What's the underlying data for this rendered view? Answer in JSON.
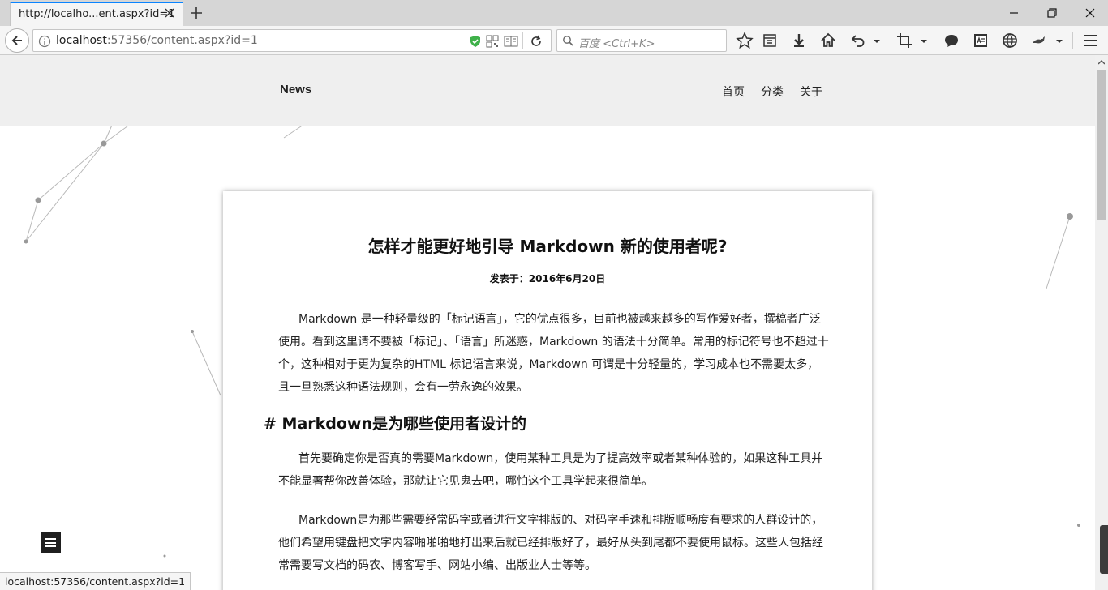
{
  "browser": {
    "tab_title": "http://localho...ent.aspx?id=1",
    "url_host": "localhost",
    "url_rest": ":57356/content.aspx?id=1",
    "search_placeholder": "百度 <Ctrl+K>",
    "status_url": "localhost:57356/content.aspx?id=1"
  },
  "site": {
    "brand": "News",
    "nav": [
      "首页",
      "分类",
      "关于"
    ]
  },
  "article": {
    "title": "怎样才能更好地引导 Markdown 新的使用者呢?",
    "date": "发表于：2016年6月20日",
    "p1": "Markdown 是一种轻量级的「标记语言」，它的优点很多，目前也被越来越多的写作爱好者，撰稿者广泛使用。看到这里请不要被「标记」、「语言」所迷惑，Markdown 的语法十分简单。常用的标记符号也不超过十个，这种相对于更为复杂的HTML 标记语言来说，Markdown 可谓是十分轻量的，学习成本也不需要太多，且一旦熟悉这种语法规则，会有一劳永逸的效果。",
    "h2": "# Markdown是为哪些使用者设计的",
    "p2": "首先要确定你是否真的需要Markdown，使用某种工具是为了提高效率或者某种体验的，如果这种工具并不能显著帮你改善体验，那就让它见鬼去吧，哪怕这个工具学起来很简单。",
    "p3": "Markdown是为那些需要经常码字或者进行文字排版的、对码字手速和排版顺畅度有要求的人群设计的，他们希望用键盘把文字内容啪啪啪地打出来后就已经排版好了，最好从头到尾都不要使用鼠标。这些人包括经常需要写文档的码农、博客写手、网站小编、出版业人士等等。"
  }
}
